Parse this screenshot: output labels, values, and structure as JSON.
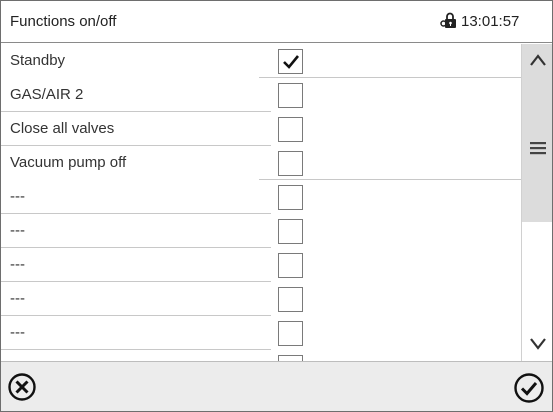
{
  "header": {
    "title": "Functions on/off",
    "time": "13:01:57",
    "lock_icon": "lock-key-icon"
  },
  "rows": [
    {
      "label": "Standby",
      "checked": true
    },
    {
      "label": "GAS/AIR 2",
      "checked": false
    },
    {
      "label": "Close all valves",
      "checked": false
    },
    {
      "label": "Vacuum pump off",
      "checked": false
    },
    {
      "label": "---",
      "checked": false
    },
    {
      "label": "---",
      "checked": false
    },
    {
      "label": "---",
      "checked": false
    },
    {
      "label": "---",
      "checked": false
    },
    {
      "label": "---",
      "checked": false
    },
    {
      "label": "",
      "checked": false
    }
  ],
  "scrollbar": {
    "up_icon": "chevron-up-icon",
    "handle_icon": "menu-icon",
    "down_icon": "chevron-down-icon"
  },
  "footer": {
    "cancel_icon": "cancel-icon",
    "confirm_icon": "confirm-icon"
  },
  "colors": {
    "footer_bg": "#ececec",
    "scroll_thumb": "#dcdcdc",
    "border": "#7a7a7a"
  }
}
